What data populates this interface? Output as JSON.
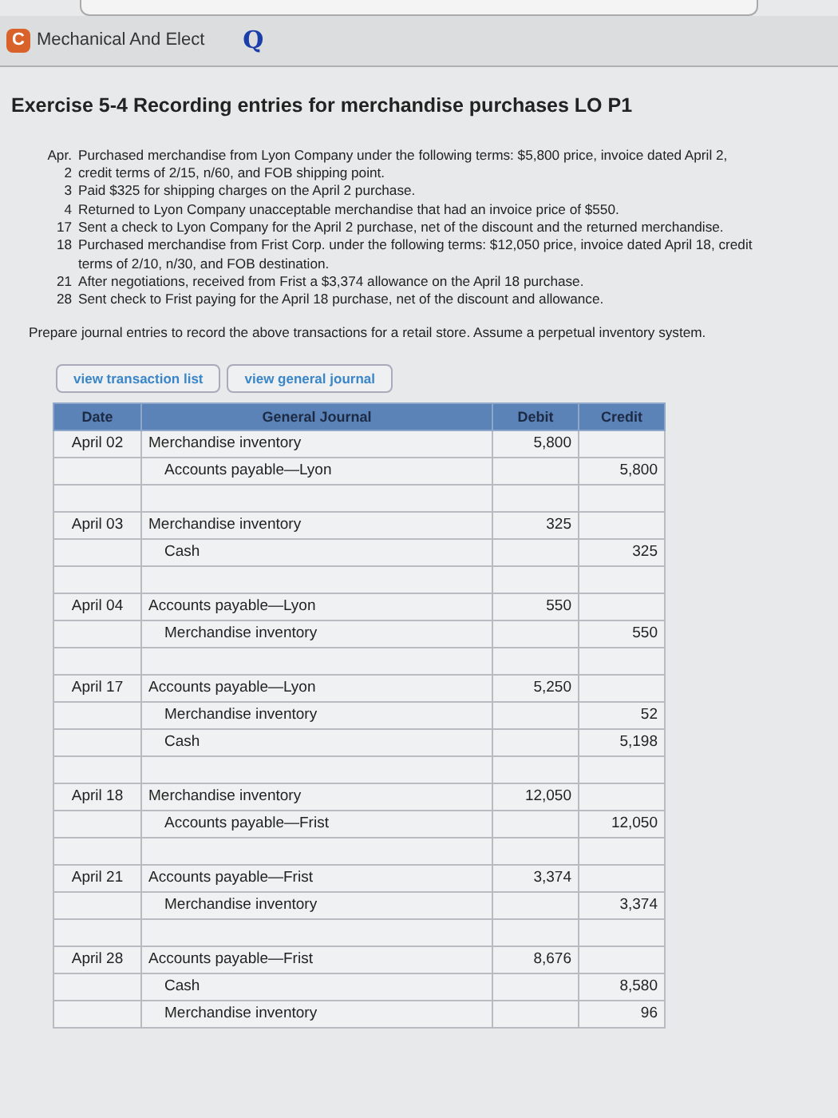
{
  "browser_tab": {
    "icon_letter": "C",
    "title": "Mechanical And Elect",
    "bookmark_glyph": "Q"
  },
  "title": "Exercise 5-4 Recording entries for merchandise purchases LO P1",
  "transactions": [
    {
      "day": "Apr. 2",
      "text": "Purchased merchandise from Lyon Company under the following terms: $5,800 price, invoice dated April 2, credit terms of 2/15, n/60, and FOB shipping point."
    },
    {
      "day": "3",
      "text": "Paid $325 for shipping charges on the April 2 purchase."
    },
    {
      "day": "4",
      "text": "Returned to Lyon Company unacceptable merchandise that had an invoice price of $550."
    },
    {
      "day": "17",
      "text": "Sent a check to Lyon Company for the April 2 purchase, net of the discount and the returned merchandise."
    },
    {
      "day": "18",
      "text": "Purchased merchandise from Frist Corp. under the following terms: $12,050 price, invoice dated April 18, credit terms of 2/10, n/30, and FOB destination."
    },
    {
      "day": "21",
      "text": "After negotiations, received from Frist a $3,374 allowance on the April 18 purchase."
    },
    {
      "day": "28",
      "text": "Sent check to Frist paying for the April 18 purchase, net of the discount and allowance."
    }
  ],
  "instructions": "Prepare journal entries to record the above transactions for a retail store. Assume a perpetual inventory system.",
  "buttons": [
    "view transaction list",
    "view general journal"
  ],
  "journal": {
    "columns": [
      "Date",
      "General Journal",
      "Debit",
      "Credit"
    ],
    "entries": [
      {
        "date": "April 02",
        "lines": [
          {
            "kind": "debit",
            "account": "Merchandise inventory",
            "amount": "5,800"
          },
          {
            "kind": "credit",
            "account": "Accounts payable—Lyon",
            "amount": "5,800"
          }
        ]
      },
      {
        "date": "April 03",
        "lines": [
          {
            "kind": "debit",
            "account": "Merchandise inventory",
            "amount": "325"
          },
          {
            "kind": "credit",
            "account": "Cash",
            "amount": "325"
          }
        ]
      },
      {
        "date": "April 04",
        "lines": [
          {
            "kind": "debit",
            "account": "Accounts payable—Lyon",
            "amount": "550"
          },
          {
            "kind": "credit",
            "account": "Merchandise inventory",
            "amount": "550"
          }
        ]
      },
      {
        "date": "April 17",
        "lines": [
          {
            "kind": "debit",
            "account": "Accounts payable—Lyon",
            "amount": "5,250"
          },
          {
            "kind": "credit",
            "account": "Merchandise inventory",
            "amount": "52"
          },
          {
            "kind": "credit",
            "account": "Cash",
            "amount": "5,198"
          }
        ]
      },
      {
        "date": "April 18",
        "lines": [
          {
            "kind": "debit",
            "account": "Merchandise inventory",
            "amount": "12,050"
          },
          {
            "kind": "credit",
            "account": "Accounts payable—Frist",
            "amount": "12,050"
          }
        ]
      },
      {
        "date": "April 21",
        "lines": [
          {
            "kind": "debit",
            "account": "Accounts payable—Frist",
            "amount": "3,374"
          },
          {
            "kind": "credit",
            "account": "Merchandise inventory",
            "amount": "3,374"
          }
        ]
      },
      {
        "date": "April 28",
        "lines": [
          {
            "kind": "debit",
            "account": "Accounts payable—Frist",
            "amount": "8,676"
          },
          {
            "kind": "credit",
            "account": "Cash",
            "amount": "8,580"
          },
          {
            "kind": "credit",
            "account": "Merchandise inventory",
            "amount": "96"
          }
        ]
      }
    ]
  }
}
